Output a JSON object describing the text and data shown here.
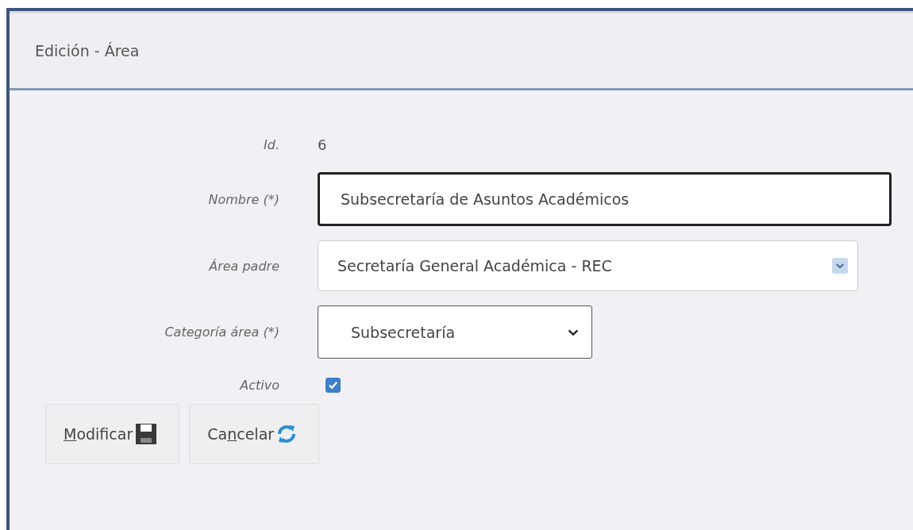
{
  "panel": {
    "title": "Edición - Área"
  },
  "fields": [
    {
      "kind": "static",
      "label": "Id.",
      "value": "6"
    },
    {
      "kind": "text",
      "label": "Nombre (*)",
      "value": "Subsecretaría de Asuntos Académicos",
      "focused": true
    },
    {
      "kind": "combo",
      "label": "Área padre",
      "value": "Secretaría General Académica - REC"
    },
    {
      "kind": "select",
      "label": "Categoría área (*)",
      "value": "Subsecretaría"
    },
    {
      "kind": "checkbox",
      "label": "Activo",
      "checked": true
    }
  ],
  "buttons": [
    {
      "kind": "save",
      "access_key": "M",
      "label_end": "odificar"
    },
    {
      "kind": "cancel",
      "label_start": "Ca",
      "access_key": "n",
      "label_end": "celar"
    }
  ]
}
